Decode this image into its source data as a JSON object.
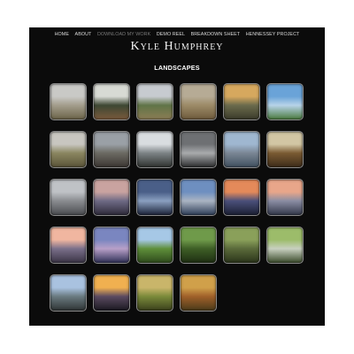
{
  "nav": {
    "items": [
      {
        "label": "HOME",
        "active": false
      },
      {
        "label": "ABOUT",
        "active": false
      },
      {
        "label": "DOWNLOAD MY WORK",
        "active": true
      },
      {
        "label": "DEMO REEL",
        "active": false
      },
      {
        "label": "BREAKDOWN SHEET",
        "active": false
      },
      {
        "label": "HENNESSEY PROJECT",
        "active": false
      }
    ]
  },
  "site": {
    "title": "Kyle Humphrey"
  },
  "section": {
    "title": "LANDSCAPES"
  },
  "gallery": {
    "thumbnails": [
      {
        "desc": "blossom-tree",
        "colors": [
          "#c9c9c6",
          "#a39d8c",
          "#6b6348"
        ]
      },
      {
        "desc": "boardwalk-trees",
        "colors": [
          "#d8dad4",
          "#3d4733",
          "#7a5a3c"
        ]
      },
      {
        "desc": "rolling-hills",
        "colors": [
          "#c7cbd0",
          "#607447",
          "#8c7d55"
        ]
      },
      {
        "desc": "fog-field",
        "colors": [
          "#b6ab95",
          "#9c8a67",
          "#6e5a3c"
        ]
      },
      {
        "desc": "marsh-sunset",
        "colors": [
          "#d6a85e",
          "#6a6a4c",
          "#3a3a2a"
        ]
      },
      {
        "desc": "blue-sky-wetland",
        "colors": [
          "#6aa3d8",
          "#b7d3e8",
          "#4a7a3d"
        ]
      },
      {
        "desc": "grass-plain",
        "colors": [
          "#c8c6c0",
          "#8a8660",
          "#5a5438"
        ]
      },
      {
        "desc": "cliff-person",
        "colors": [
          "#9aa0a6",
          "#6b6a62",
          "#3b3632"
        ]
      },
      {
        "desc": "lake-reflection",
        "colors": [
          "#d9dde0",
          "#7c8385",
          "#2f3330"
        ]
      },
      {
        "desc": "storm-lake",
        "colors": [
          "#6e7073",
          "#a9abad",
          "#2c2d2e"
        ]
      },
      {
        "desc": "city-skyline-day",
        "colors": [
          "#9fb7d0",
          "#7a8694",
          "#405060"
        ]
      },
      {
        "desc": "tree-row",
        "colors": [
          "#d2c6a4",
          "#7a5a32",
          "#3d2c1a"
        ]
      },
      {
        "desc": "flatiron-building",
        "colors": [
          "#bfc2c6",
          "#8a8c90",
          "#4a4c50"
        ]
      },
      {
        "desc": "bridge-sunset",
        "colors": [
          "#c9a3a0",
          "#6e6a85",
          "#2e2a3a"
        ]
      },
      {
        "desc": "bridge-night",
        "colors": [
          "#4a5f88",
          "#8aa0c0",
          "#1b2238"
        ]
      },
      {
        "desc": "harbor-skyline",
        "colors": [
          "#6e8fc0",
          "#aab4c2",
          "#2d3d58"
        ]
      },
      {
        "desc": "city-dusk",
        "colors": [
          "#e48a5a",
          "#4a4f7a",
          "#1b1f33"
        ]
      },
      {
        "desc": "skyline-water",
        "colors": [
          "#e8a68a",
          "#8a8da3",
          "#33384a"
        ]
      },
      {
        "desc": "ferry-pier",
        "colors": [
          "#f0b6a0",
          "#7a6f8a",
          "#3a3445"
        ]
      },
      {
        "desc": "carousel-night",
        "colors": [
          "#7a86c0",
          "#b8a0c8",
          "#2e2f55"
        ]
      },
      {
        "desc": "green-meadow",
        "colors": [
          "#a6c8e6",
          "#5e8f3a",
          "#2f4a1c"
        ]
      },
      {
        "desc": "forest-stream",
        "colors": [
          "#6f9a4a",
          "#3e5e26",
          "#1e2e12"
        ]
      },
      {
        "desc": "woods-brook",
        "colors": [
          "#8aa05a",
          "#5a6a3a",
          "#2a341a"
        ]
      },
      {
        "desc": "waterfall-rocks",
        "colors": [
          "#9cbc6a",
          "#c8d0c0",
          "#3a4a2a"
        ]
      },
      {
        "desc": "rocky-shore",
        "colors": [
          "#a9c2e0",
          "#6a7a80",
          "#2e3434"
        ]
      },
      {
        "desc": "bridge-lights",
        "colors": [
          "#f0b050",
          "#5a4a60",
          "#1a1820"
        ]
      },
      {
        "desc": "prairie-sunset",
        "colors": [
          "#c9b56a",
          "#7a8a3a",
          "#3a401c"
        ]
      },
      {
        "desc": "autumn-path",
        "colors": [
          "#d0a04a",
          "#a0602a",
          "#4a3a1a"
        ]
      }
    ]
  }
}
